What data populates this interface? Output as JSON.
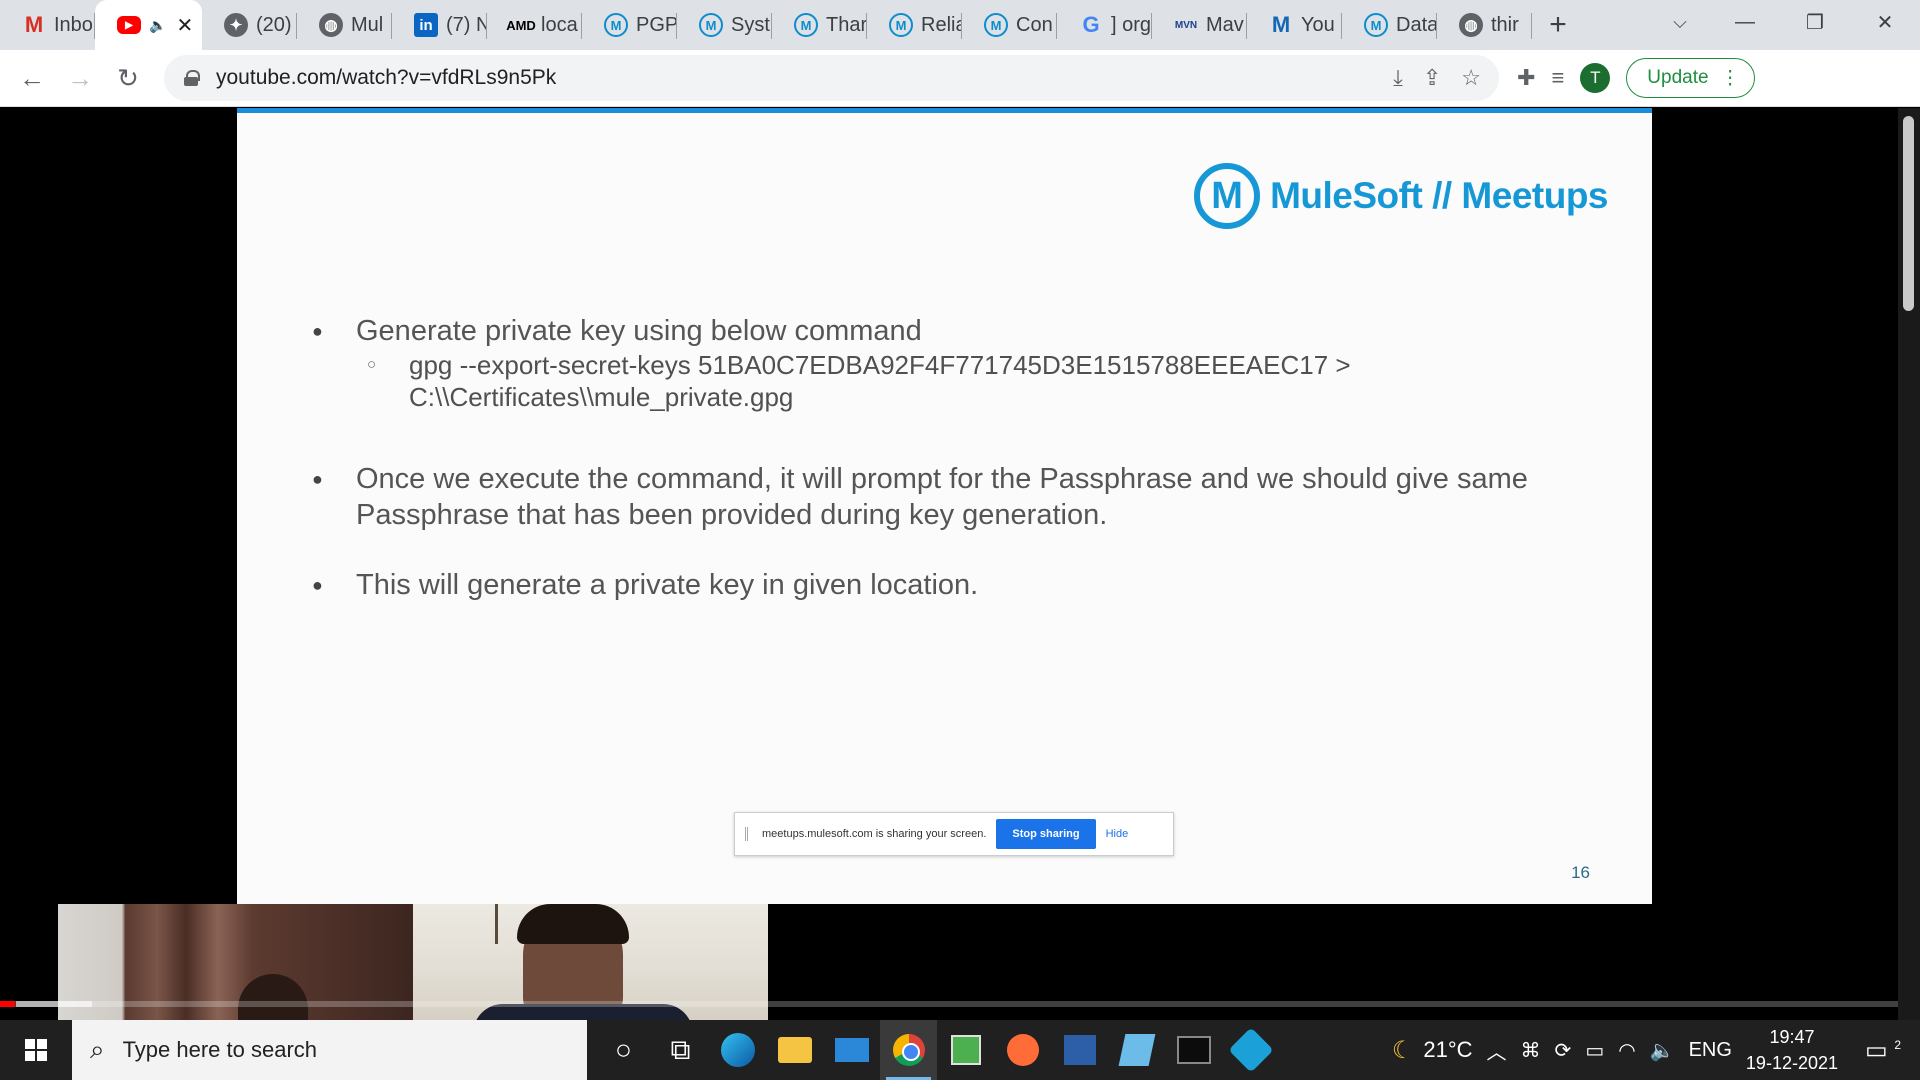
{
  "browser": {
    "tabs": [
      {
        "title": "Inbo",
        "icon": "gmail-icon",
        "glyph": "M"
      },
      {
        "title": "",
        "icon": "youtube-icon",
        "glyph": "▶",
        "active": true,
        "audio": "🔈",
        "close": "✕"
      },
      {
        "title": "(20)",
        "icon": "copilot-icon",
        "glyph": "✦"
      },
      {
        "title": "Mul",
        "icon": "globe-icon",
        "glyph": "◍"
      },
      {
        "title": "(7) N",
        "icon": "linkedin-icon",
        "glyph": "in"
      },
      {
        "title": "loca",
        "icon": "amd-icon",
        "glyph": "AMD"
      },
      {
        "title": "PGP",
        "icon": "mulesoft-icon",
        "glyph": "M"
      },
      {
        "title": "Syst",
        "icon": "mulesoft-icon",
        "glyph": "M"
      },
      {
        "title": "Thar",
        "icon": "mulesoft-icon",
        "glyph": "M"
      },
      {
        "title": "Relia",
        "icon": "mulesoft-icon",
        "glyph": "M"
      },
      {
        "title": "Con",
        "icon": "mulesoft-icon",
        "glyph": "M"
      },
      {
        "title": "] org",
        "icon": "google-icon",
        "glyph": "G"
      },
      {
        "title": "Mav",
        "icon": "mvn-icon",
        "glyph": "MVN"
      },
      {
        "title": "You",
        "icon": "moodle-icon",
        "glyph": "M"
      },
      {
        "title": "Data",
        "icon": "mulesoft-icon",
        "glyph": "M"
      },
      {
        "title": "thir",
        "icon": "globe-icon",
        "glyph": "◍"
      }
    ],
    "new_tab": "+",
    "tab_search": "⌵",
    "window_controls": {
      "minimize": "—",
      "restore": "❐",
      "close": "✕"
    },
    "nav": {
      "back": "←",
      "forward": "→",
      "reload": "↻"
    },
    "url": "youtube.com/watch?v=vfdRLs9n5Pk",
    "omnibox_icons": {
      "install": "⤓",
      "share": "⇪",
      "bookmark": "☆"
    },
    "toolbar_icons": {
      "extensions": "✚",
      "reading_list": "≡"
    },
    "profile_initial": "T",
    "update_label": "Update",
    "menu": "⋮"
  },
  "slide": {
    "brand": "MuleSoft // Meetups",
    "brand_logo": "M",
    "bullets": [
      {
        "text": "Generate private key using below command",
        "sub": "gpg --export-secret-keys  51BA0C7EDBA92F4F771745D3E1515788EEEAEC17 > C:\\\\Certificates\\\\mule_private.gpg"
      },
      {
        "text": "Once we execute the command, it will prompt for the Passphrase and we should give same Passphrase that has been provided during key generation."
      },
      {
        "text": "This will generate a  private key in given location."
      }
    ],
    "share_notice": "meetups.mulesoft.com is sharing your screen.",
    "stop_sharing": "Stop sharing",
    "hide": "Hide",
    "page_number": "16"
  },
  "video": {
    "progress_fraction": 0.008
  },
  "taskbar": {
    "search_placeholder": "Type here to search",
    "search_glyph": "⌕",
    "cortana_glyph": "○",
    "taskview_glyph": "⧉",
    "weather_icon": "☾",
    "temperature": "21°C",
    "tray_chevron": "︿",
    "language": "ENG",
    "time": "19:47",
    "date": "19-12-2021",
    "notifications": "2"
  }
}
